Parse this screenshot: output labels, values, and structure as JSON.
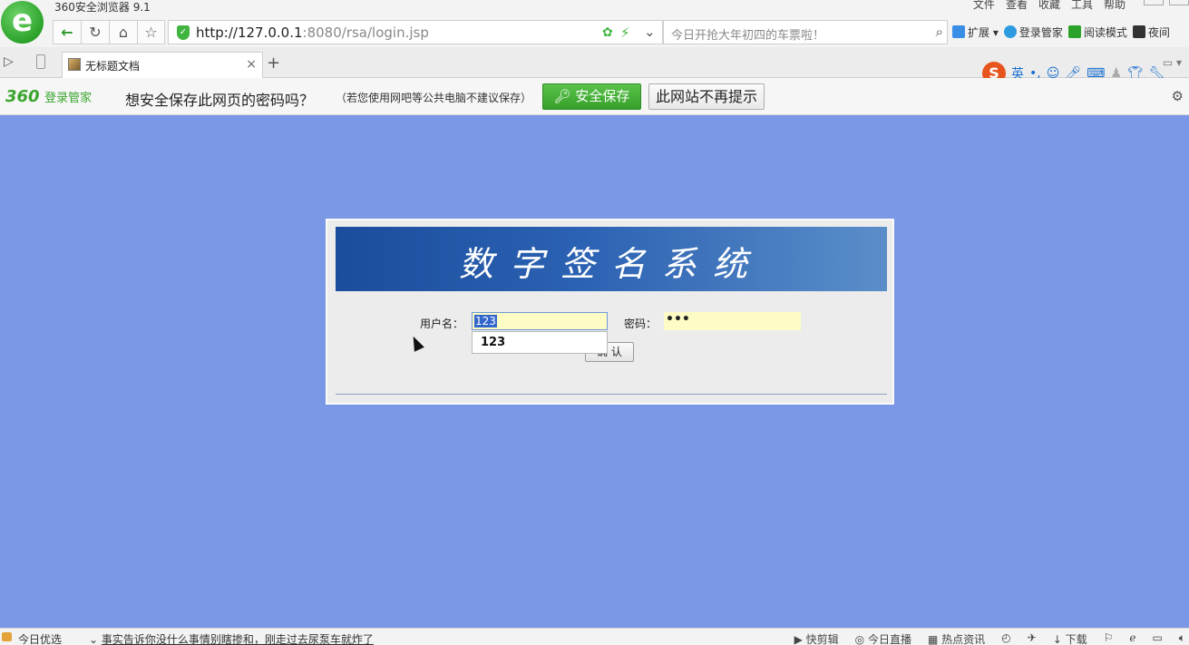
{
  "browser": {
    "title": "360安全浏览器 9.1",
    "menu": [
      "文件",
      "查看",
      "收藏",
      "工具",
      "帮助"
    ],
    "url_host": "http://127.0.0.1",
    "url_rest": ":8080/rsa/login.jsp",
    "search_placeholder": "今日开抢大年初四的车票啦！",
    "extensions": [
      {
        "label": "扩展",
        "color": "#3a8ee6"
      },
      {
        "label": "登录管家",
        "color": "#2e9be0"
      },
      {
        "label": "阅读模式",
        "color": "#2ba22a"
      },
      {
        "label": "夜间",
        "color": "#333333"
      }
    ],
    "tab_title": "无标题文档",
    "ime_label": "英"
  },
  "password_bar": {
    "brand_num": "360",
    "brand_text": "登录管家",
    "question": "想安全保存此网页的密码吗？",
    "tip": "（若您使用网吧等公共电脑不建议保存）",
    "save_label": "安全保存",
    "never_label": "此网站不再提示"
  },
  "page": {
    "banner_title": "数字签名系统",
    "username_label": "用户名：",
    "username_value": "123",
    "password_label": "密码：",
    "password_value": "•••",
    "autocomplete_option": "123",
    "submit_label": "确 认",
    "background_color": "#7b98e6"
  },
  "status": {
    "left_label": "今日优选",
    "news": "事实告诉你没什么事情别瞎掺和，刚走过去尿泵车就炸了",
    "right_items": [
      "快剪辑",
      "今日直播",
      "热点资讯",
      "下载"
    ]
  }
}
